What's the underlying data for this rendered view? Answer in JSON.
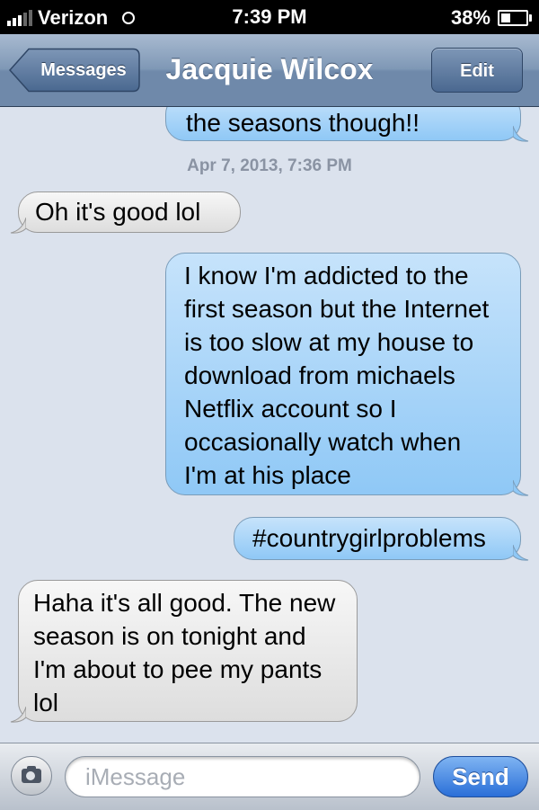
{
  "status_bar": {
    "carrier": "Verizon",
    "time": "7:39 PM",
    "battery_percent": "38%",
    "battery_level": 0.38,
    "signal_bars": 3
  },
  "nav": {
    "back_label": "Messages",
    "title": "Jacquie Wilcox",
    "edit_label": "Edit"
  },
  "conversation": {
    "timestamp": "Apr 7, 2013, 7:36 PM",
    "messages": [
      {
        "direction": "out",
        "text": "the seasons though!!"
      },
      {
        "direction": "in",
        "text": "Oh it's good lol"
      },
      {
        "direction": "out",
        "text": "I know I'm addicted to the first season but the Internet is too slow at my house to download from michaels Netflix account so I occasionally watch when I'm at his place"
      },
      {
        "direction": "out",
        "text": "#countrygirlproblems"
      },
      {
        "direction": "in",
        "text": "Haha it's all good. The new season is on tonight and I'm about to pee my pants lol"
      }
    ]
  },
  "input_bar": {
    "camera_icon": "camera-icon",
    "placeholder": "iMessage",
    "value": "",
    "send_label": "Send"
  },
  "colors": {
    "outgoing_bubble": "#9ccdf7",
    "incoming_bubble": "#e8e8e8",
    "background": "#dbe2ed",
    "send_button": "#2a6fd8"
  }
}
